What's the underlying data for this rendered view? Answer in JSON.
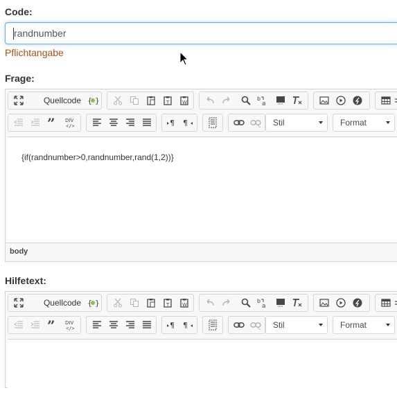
{
  "code": {
    "label": "Code:",
    "value": "randnumber",
    "hint": "Pflichtangabe"
  },
  "frage": {
    "label": "Frage:",
    "content": "{if(randnumber>0,randnumber,rand(1,2))}",
    "path": "body"
  },
  "hilfetext": {
    "label": "Hilfetext:",
    "content": ""
  },
  "toolbar": {
    "source_label": "Quellcode",
    "style_label": "Stil",
    "format_label": "Format",
    "div_label": "DIV"
  },
  "icons": [
    "maximize-icon",
    "source-icon",
    "cut-icon",
    "copy-icon",
    "paste-icon",
    "paste-text-icon",
    "paste-word-icon",
    "undo-icon",
    "redo-icon",
    "find-icon",
    "replace-icon",
    "select-all-icon",
    "remove-format-icon",
    "image-icon",
    "video-icon",
    "flash-icon",
    "table-icon",
    "numbered-list-icon",
    "bulleted-list-icon",
    "blockquote-icon",
    "div-container-icon",
    "align-left-icon",
    "align-center-icon",
    "align-right-icon",
    "justify-icon",
    "ltr-icon",
    "rtl-icon",
    "show-blocks-icon",
    "link-icon",
    "unlink-icon"
  ],
  "colors": {
    "focus_border": "#66afe9",
    "hint": "#a94f1a"
  }
}
